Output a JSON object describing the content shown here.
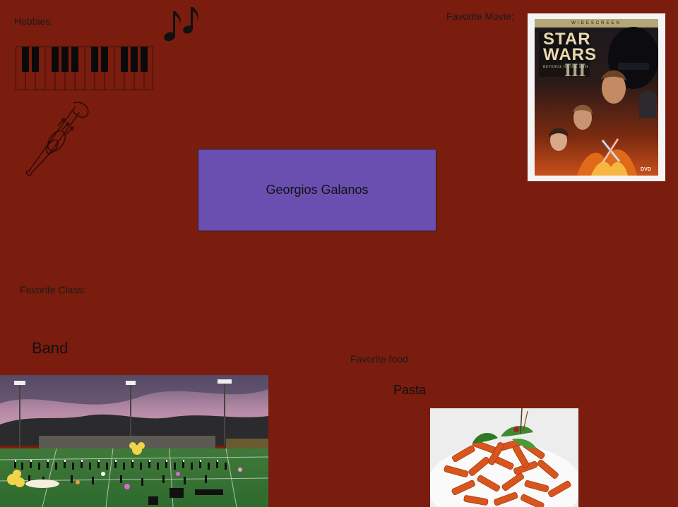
{
  "labels": {
    "hobbies": "Hobbies:",
    "favorite_movie": "Favorite Movie:",
    "favorite_class": "Favorite Class:",
    "class_value": "Band",
    "favorite_food": "Favorite food:",
    "food_value": "Pasta"
  },
  "name_box": {
    "name": "Georgios Galanos"
  },
  "poster": {
    "banner": "WIDESCREEN",
    "title_line1": "STAR",
    "title_line2": "WARS",
    "episode": "III",
    "subtitle": "REVENGE OF THE SITH",
    "format": "DVD"
  },
  "colors": {
    "background": "#7a1c0e",
    "name_box": "#6a4fb0"
  },
  "icons": [
    "music-notes-icon",
    "piano-keys-icon",
    "trumpet-icon"
  ]
}
